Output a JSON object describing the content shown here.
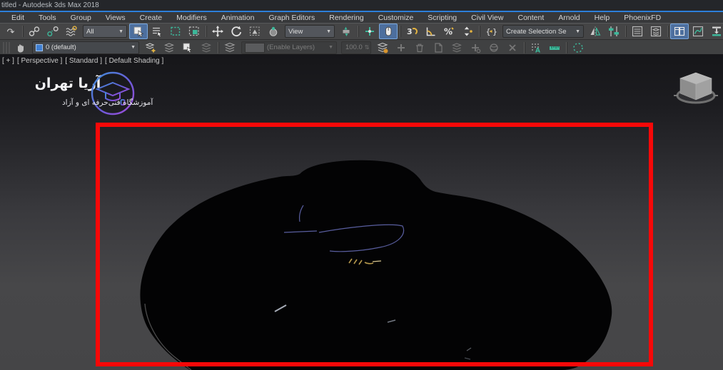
{
  "window": {
    "title": "titled - Autodesk 3ds Max 2018"
  },
  "menu": {
    "items": [
      "Edit",
      "Tools",
      "Group",
      "Views",
      "Create",
      "Modifiers",
      "Animation",
      "Graph Editors",
      "Rendering",
      "Customize",
      "Scripting",
      "Civil View",
      "Content",
      "Arnold",
      "Help",
      "PhoenixFD"
    ]
  },
  "toolbar_main": {
    "selection_filter_value": "All",
    "coordinate_system_value": "View",
    "selection_set_placeholder": "Create Selection Se"
  },
  "toolbar_layers": {
    "current_layer": "0 (default)",
    "anim_layers_value": "(Enable Layers)",
    "anim_weight": "100.0"
  },
  "viewport": {
    "label_general": "[ + ]",
    "label_pov": "[ Perspective ]",
    "label_renderer": "[ Standard ]",
    "label_shading": "[ Default Shading ]"
  },
  "watermark": {
    "title": "آریا تهران",
    "subtitle": "آموزشگاه فنی‌حرفه ای و آزاد"
  },
  "icons": {
    "redo": "↷",
    "snap_3d": "3",
    "angle_snap": "∠",
    "percent_snap": "%",
    "spinner_snap": "⇅",
    "caret": "▼",
    "braces_open": "{",
    "braces_close": "}"
  },
  "colors": {
    "annotation_red": "#f70808",
    "accent_blue": "#2d7fd9",
    "teal": "#3db79a",
    "yellow": "#e3b341"
  }
}
